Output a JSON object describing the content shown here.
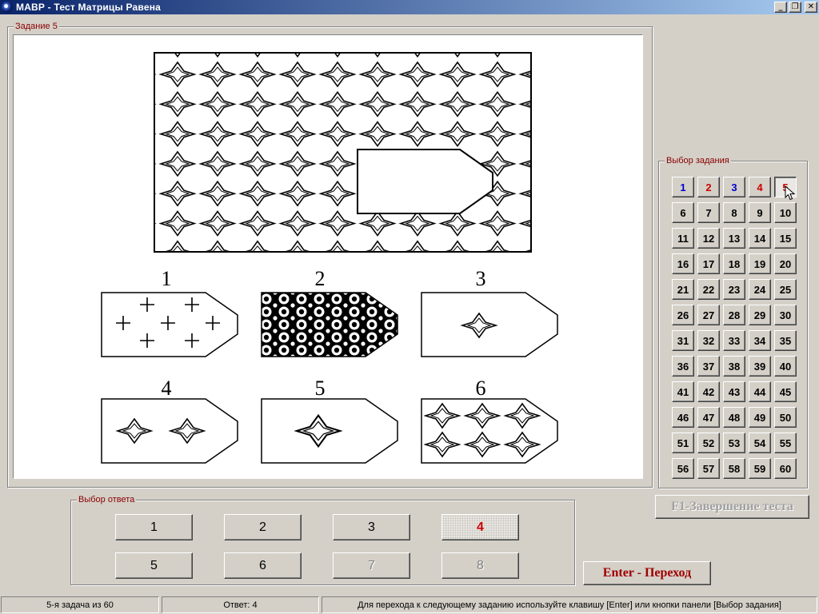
{
  "window": {
    "title": "МАВР - Тест Матрицы Равена",
    "icons": [
      "app-icon",
      "minimize-icon",
      "restore-icon",
      "close-icon"
    ]
  },
  "task_panel": {
    "legend": "Задание 5",
    "option_numbers": [
      "1",
      "2",
      "3",
      "4",
      "5",
      "6"
    ]
  },
  "answer_panel": {
    "legend": "Выбор ответа",
    "buttons": [
      {
        "label": "1",
        "state": "enabled"
      },
      {
        "label": "2",
        "state": "enabled"
      },
      {
        "label": "3",
        "state": "enabled"
      },
      {
        "label": "4",
        "state": "selected"
      },
      {
        "label": "5",
        "state": "enabled"
      },
      {
        "label": "6",
        "state": "enabled"
      },
      {
        "label": "7",
        "state": "disabled"
      },
      {
        "label": "8",
        "state": "disabled"
      }
    ]
  },
  "select_panel": {
    "legend": "Выбор задания",
    "task_numbers": [
      "1",
      "2",
      "3",
      "4",
      "5",
      "6",
      "7",
      "8",
      "9",
      "10",
      "11",
      "12",
      "13",
      "14",
      "15",
      "16",
      "17",
      "18",
      "19",
      "20",
      "21",
      "22",
      "23",
      "24",
      "25",
      "26",
      "27",
      "28",
      "29",
      "30",
      "31",
      "32",
      "33",
      "34",
      "35",
      "36",
      "37",
      "38",
      "39",
      "40",
      "41",
      "42",
      "43",
      "44",
      "45",
      "46",
      "47",
      "48",
      "49",
      "50",
      "51",
      "52",
      "53",
      "54",
      "55",
      "56",
      "57",
      "58",
      "59",
      "60"
    ],
    "answered_tasks": [
      "1",
      "2",
      "3",
      "4"
    ],
    "current_task": "5"
  },
  "colors": {
    "title_start": "#0a246a",
    "title_end": "#a6caf0",
    "answered_a": "#0000cc",
    "answered_b": "#cc0000",
    "current": "#cc0000",
    "legend": "#8b0000"
  },
  "finish_button": "F1-Завершение теста",
  "enter_button": "Enter - Переход",
  "status": {
    "task": "5-я задача из 60",
    "answer": "Ответ: 4",
    "hint": "Для перехода к следующему заданию используйте клавишу [Enter] или кнопки панели [Выбор задания]"
  }
}
